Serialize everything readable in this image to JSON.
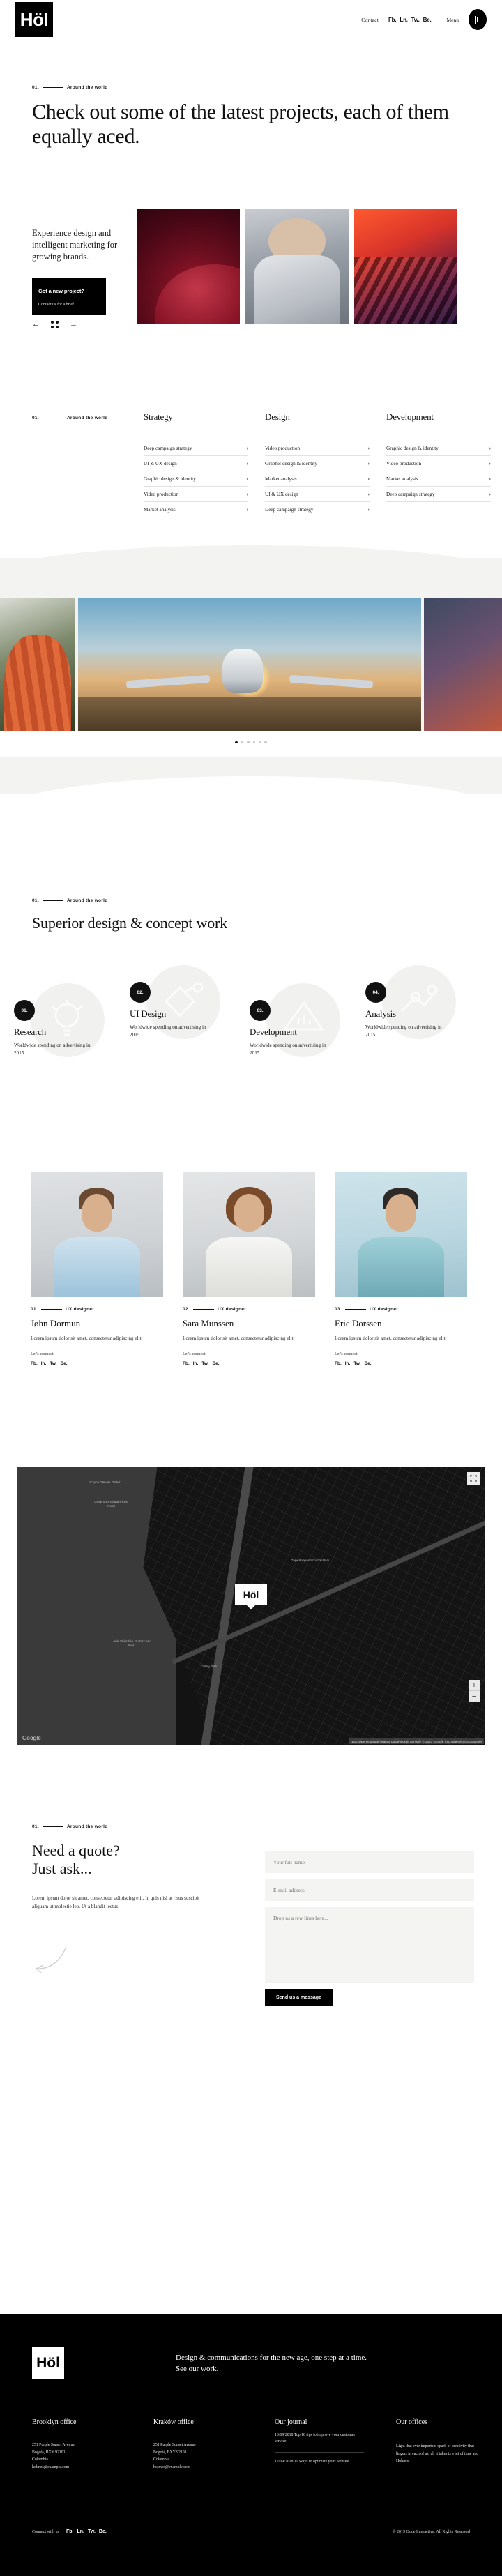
{
  "brand": {
    "logo": "Höl"
  },
  "header": {
    "contact_label": "Contact",
    "socials": [
      "Fb.",
      "Ln.",
      "Tw.",
      "Be."
    ],
    "menu_label": "Menu",
    "burger_icon": "hamburger-icon"
  },
  "hero": {
    "eyebrow_num": "01.",
    "eyebrow_text": "Around the world",
    "headline": "Check out some of the latest projects, each of them equally aced."
  },
  "slider": {
    "caption": "Experience design and intelligent marketing for growing brands.",
    "cta_title": "Got a new project?",
    "cta_sub": "Contact us for a brief",
    "prev_icon": "arrow-left-icon",
    "grid_icon": "grid-icon",
    "next_icon": "arrow-right-icon"
  },
  "services": {
    "eyebrow_num": "01.",
    "eyebrow_text": "Around the world",
    "columns": [
      {
        "title": "Strategy",
        "items": [
          "Deep campaign strategy",
          "UI & UX design",
          "Graphic design & identity",
          "Video production",
          "Market analysis"
        ]
      },
      {
        "title": "Design",
        "items": [
          "Video production",
          "Graphic design & identity",
          "Market analysis",
          "UI & UX design",
          "Deep campaign strategy"
        ]
      },
      {
        "title": "Development",
        "items": [
          "Graphic design & identity",
          "Video production",
          "Market analysis",
          "Deep campaign strategy"
        ]
      }
    ],
    "chevron": "›"
  },
  "gallery": {
    "dots": 6,
    "active_dot": 1
  },
  "concept": {
    "eyebrow_num": "01.",
    "eyebrow_text": "Around the world",
    "heading": "Superior design & concept work",
    "steps": [
      {
        "num": "01.",
        "title": "Research",
        "text": "Worldwide spending on advertising in 2015.",
        "icon": "lightbulb-icon"
      },
      {
        "num": "02.",
        "title": "UI Design",
        "text": "Worldwide spending on advertising in 2015.",
        "icon": "pen-tool-icon"
      },
      {
        "num": "03.",
        "title": "Development",
        "text": "Worldwide spending on advertising in 2015.",
        "icon": "ruler-icon"
      },
      {
        "num": "04.",
        "title": "Analysis",
        "text": "Worldwide spending on advertising in 2015.",
        "icon": "chart-icon"
      }
    ]
  },
  "team": {
    "members": [
      {
        "num": "01.",
        "role": "UX designer",
        "name": "Jøhn Dormun",
        "bio": "Lorem ipsum dolor sit amet, consectetur adipiscing elit.",
        "connect_label": "Let's connect",
        "socials": [
          "Fb.",
          "In.",
          "Tw.",
          "Be."
        ]
      },
      {
        "num": "02.",
        "role": "UX designer",
        "name": "Sara Munssen",
        "bio": "Lorem ipsum dolor sit amet, consectetur adipiscing elit.",
        "connect_label": "Let's connect",
        "socials": [
          "Fb.",
          "In.",
          "Tw.",
          "Be."
        ]
      },
      {
        "num": "03.",
        "role": "UX designer",
        "name": "Eric Dorssen",
        "bio": "Lorem ipsum dolor sit amet, consectetur adipiscing elit.",
        "connect_label": "Let's connect",
        "socials": [
          "Fb.",
          "In.",
          "Tw.",
          "Be."
        ]
      }
    ]
  },
  "map": {
    "pin_label": "Höl",
    "attribution": "Google",
    "credits": "Быстрые клавиши  |  Картографические данные © 2023 Google  |  Условия использования",
    "fullscreen_icon": "fullscreen-icon",
    "zoom_in": "+",
    "zoom_out": "−",
    "labels": [
      "остров Пикник Пойнт",
      "Governors Island Picnic Point",
      "Louis Valentino Jr. Park and Pier",
      "Coffey Park",
      "Парк Кэрролл Carroll Park"
    ]
  },
  "quote": {
    "eyebrow_num": "01.",
    "eyebrow_text": "Around the world",
    "heading_line1": "Need a quote?",
    "heading_line2": "Just ask...",
    "body": "Lorem ipsum dolor sit amet, consectetur adipiscing elit. In quis nisl at risus suscipit aliquam ut molestie leo. Ut a blandit lectus.",
    "arrow_icon": "curved-arrow-icon"
  },
  "form": {
    "name_placeholder": "Your full name",
    "email_placeholder": "E-mail address",
    "message_placeholder": "Drop us a few lines here...",
    "submit_label": "Send us a message"
  },
  "footer": {
    "logo": "Höl",
    "tagline": "Design & communications for the new age, one step at a time.",
    "link_label": "See our work.",
    "offices": [
      {
        "title": "Brooklyn office",
        "address": "251 Purple Sunset Avenue\nBogotá, BXY 92101\nColombia\nholmes@example.com"
      },
      {
        "title": "Kraków office",
        "address": "251 Purple Sunset Avenue\nBogotá, BXY 92101\nColombia\nholmes@example.com"
      }
    ],
    "journal": {
      "title": "Our journal",
      "items": [
        "10/09/2018 Top 10 tips to improve your customer service",
        "12/09/2018 11 Ways to optimize your website"
      ]
    },
    "offices_note": {
      "title": "Our offices",
      "text": "Light that ever important spark of creativity that lingers in each of us, all it takes is a bit of time and Holmes."
    },
    "connect_label": "Connect with us",
    "socials": [
      "Fb.",
      "Ln.",
      "Tw.",
      "Be."
    ],
    "copyright": "© 2019 Qode Interactive, All Rights Reserved"
  }
}
